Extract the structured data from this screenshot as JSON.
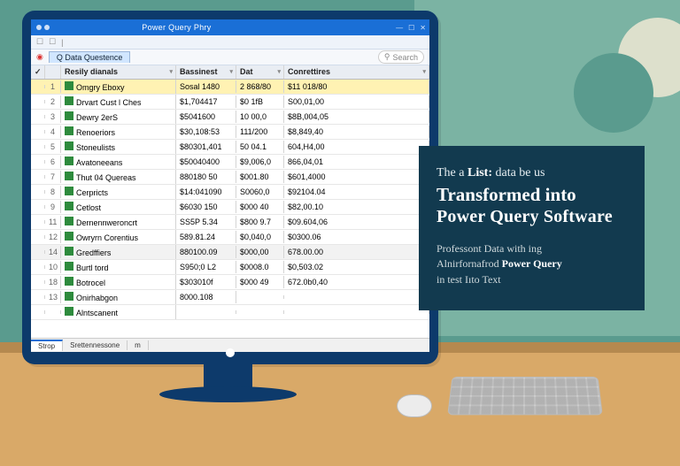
{
  "window": {
    "title": "Power Query Phry",
    "breadcrumb": "Q Data Questence",
    "search_placeholder": "Search"
  },
  "headers": {
    "check": "✓",
    "name": "Resily dianals",
    "col_a": "Bassinest",
    "col_b": "Dat",
    "col_c": "Conrettires"
  },
  "rows": [
    {
      "n": "1",
      "name": "Omgry Eboxy",
      "a": "Sosal 1480",
      "b": "2 868/80",
      "c": "$11 018/80",
      "sel": true
    },
    {
      "n": "2",
      "name": "Drvart Cust l Ches",
      "a": "$1,704417",
      "b": "$0 1fB",
      "c": "S00,01,00"
    },
    {
      "n": "3",
      "name": "Dewry 2erS",
      "a": "$5041600",
      "b": "10 00,0",
      "c": "$8B,004,05"
    },
    {
      "n": "4",
      "name": "Renoeriors",
      "a": "$30,108:53",
      "b": "111/200",
      "c": "$8,849,40"
    },
    {
      "n": "5",
      "name": "Stoneulists",
      "a": "$80301,401",
      "b": "50 04.1",
      "c": "604,H4,00"
    },
    {
      "n": "6",
      "name": "Avatoneeans",
      "a": "$50040400",
      "b": "$9,006,0",
      "c": "866,04,01"
    },
    {
      "n": "7",
      "name": "Thut 04 Quereas",
      "a": "880180 50",
      "b": "$001.80",
      "c": "$601,4000"
    },
    {
      "n": "8",
      "name": "Cerpricts",
      "a": "$14:041090",
      "b": "S0060,0",
      "c": "$92104.04"
    },
    {
      "n": "9",
      "name": "Cetlost",
      "a": "$6030 150",
      "b": "$000 40",
      "c": "$82,00.10"
    },
    {
      "n": "11",
      "name": "Dernennweroncrt",
      "a": "SS5P 5.34",
      "b": "$800 9.7",
      "c": "$09.604,06"
    },
    {
      "n": "12",
      "name": "Owryrn Corentius",
      "a": "589.81.24",
      "b": "$0,040,0",
      "c": "$0300.06"
    },
    {
      "n": "14",
      "name": "Gredffiers",
      "a": "880100.09",
      "b": "$000,00",
      "c": "678.00.00",
      "sel2": true
    },
    {
      "n": "10",
      "name": "Burtl tord",
      "a": "S950;0 L2",
      "b": "$0008.0",
      "c": "$0,503.02"
    },
    {
      "n": "18",
      "name": "Botrocel",
      "a": "$303010f",
      "b": "$000 49",
      "c": "672.0b0,40"
    },
    {
      "n": "13",
      "name": "Onirhabgon",
      "a": "8000.108",
      "b": "",
      "c": ""
    },
    {
      "n": "",
      "name": "Alntscanent",
      "a": "",
      "b": "",
      "c": ""
    }
  ],
  "sheets": [
    "Strop",
    "Srettennessone",
    "m"
  ],
  "card": {
    "line1_pre": "The a ",
    "line1_b": "List:",
    "line1_post": " data be us",
    "big1": "Transformed into",
    "big2": "Power Query Software",
    "sub1_pre": "Professont Data with ing",
    "sub2_pre": "Alnirfornafrod ",
    "sub2_b": "Power Query",
    "sub3": "in test Iıto Text"
  }
}
